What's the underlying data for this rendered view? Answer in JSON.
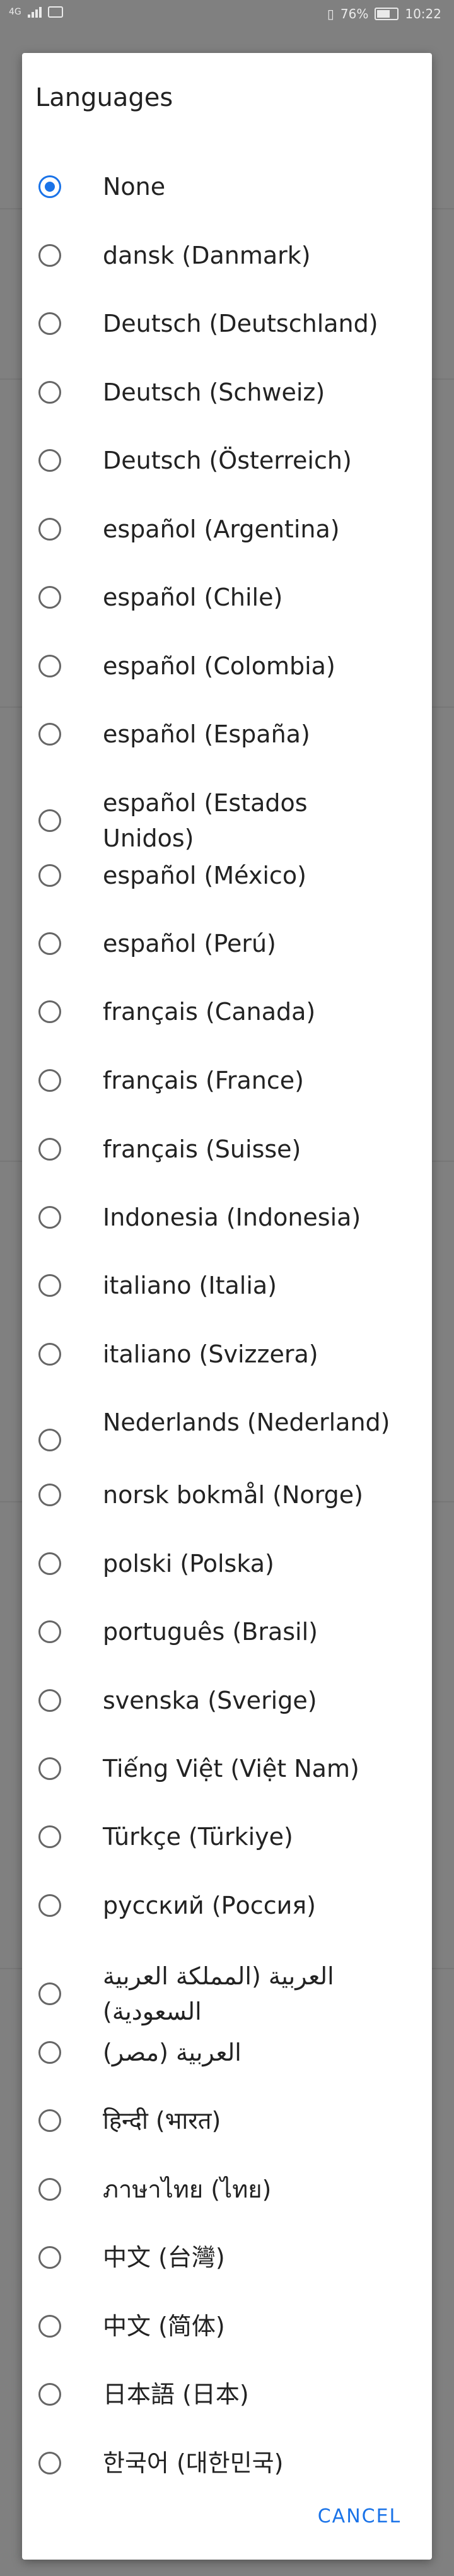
{
  "status_bar": {
    "carrier": "4G",
    "battery": "76%",
    "time": "10:22"
  },
  "dialog": {
    "title": "Languages",
    "options": [
      {
        "label": "None",
        "selected": true
      },
      {
        "label": "dansk (Danmark)",
        "selected": false
      },
      {
        "label": "Deutsch (Deutschland)",
        "selected": false
      },
      {
        "label": "Deutsch (Schweiz)",
        "selected": false
      },
      {
        "label": "Deutsch (Österreich)",
        "selected": false
      },
      {
        "label": "español (Argentina)",
        "selected": false
      },
      {
        "label": "español (Chile)",
        "selected": false
      },
      {
        "label": "español (Colombia)",
        "selected": false
      },
      {
        "label": "español (España)",
        "selected": false
      },
      {
        "label": "español (Estados Unidos)",
        "selected": false
      },
      {
        "label": "español (México)",
        "selected": false
      },
      {
        "label": "español (Perú)",
        "selected": false
      },
      {
        "label": "français (Canada)",
        "selected": false
      },
      {
        "label": "français (France)",
        "selected": false
      },
      {
        "label": "français (Suisse)",
        "selected": false
      },
      {
        "label": "Indonesia (Indonesia)",
        "selected": false
      },
      {
        "label": "italiano (Italia)",
        "selected": false
      },
      {
        "label": "italiano (Svizzera)",
        "selected": false
      },
      {
        "label": "Nederlands (Nederland)",
        "selected": false
      },
      {
        "label": "norsk bokmål (Norge)",
        "selected": false
      },
      {
        "label": "polski (Polska)",
        "selected": false
      },
      {
        "label": "português (Brasil)",
        "selected": false
      },
      {
        "label": "svenska (Sverige)",
        "selected": false
      },
      {
        "label": "Tiếng Việt (Việt Nam)",
        "selected": false
      },
      {
        "label": "Türkçe (Türkiye)",
        "selected": false
      },
      {
        "label": "русский (Россия)",
        "selected": false
      },
      {
        "label": "العربية (المملكة العربية السعودية)",
        "selected": false
      },
      {
        "label": "العربية (مصر)",
        "selected": false
      },
      {
        "label": "हिन्दी (भारत)",
        "selected": false
      },
      {
        "label": "ภาษาไทย (ไทย)",
        "selected": false
      },
      {
        "label": "中文 (台灣)",
        "selected": false
      },
      {
        "label": "中文 (简体)",
        "selected": false
      },
      {
        "label": "日本語 (日本)",
        "selected": false
      },
      {
        "label": "한국어 (대한민국)",
        "selected": false
      }
    ],
    "cancel_label": "CANCEL"
  },
  "colors": {
    "accent": "#1a73e8",
    "scrim": "#808080"
  }
}
